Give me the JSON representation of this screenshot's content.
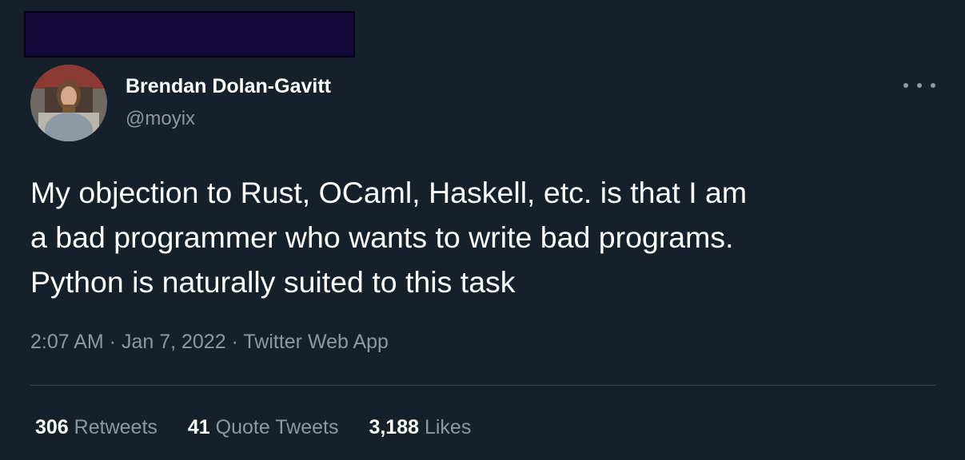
{
  "redaction": {
    "color": "#130a3b"
  },
  "author": {
    "name": "Brendan Dolan-Gavitt",
    "handle": "@moyix",
    "avatar_icon": "profile-photo"
  },
  "more_icon": "more-horizontal-icon",
  "tweet": {
    "lines": [
      "My objection to Rust, OCaml, Haskell, etc. is that I am",
      "a bad programmer who wants to write bad programs.",
      "Python is naturally suited to this task"
    ]
  },
  "meta": {
    "time": "2:07 AM",
    "separator": " · ",
    "date": "Jan 7, 2022",
    "source": "Twitter Web App"
  },
  "stats": {
    "retweets": {
      "count": "306",
      "label": "Retweets"
    },
    "quote_tweets": {
      "count": "41",
      "label": "Quote Tweets"
    },
    "likes": {
      "count": "3,188",
      "label": "Likes"
    }
  },
  "colors": {
    "background": "#15202b",
    "primary_text": "#ffffff",
    "secondary_text": "#8b98a5",
    "divider": "#38444d"
  }
}
